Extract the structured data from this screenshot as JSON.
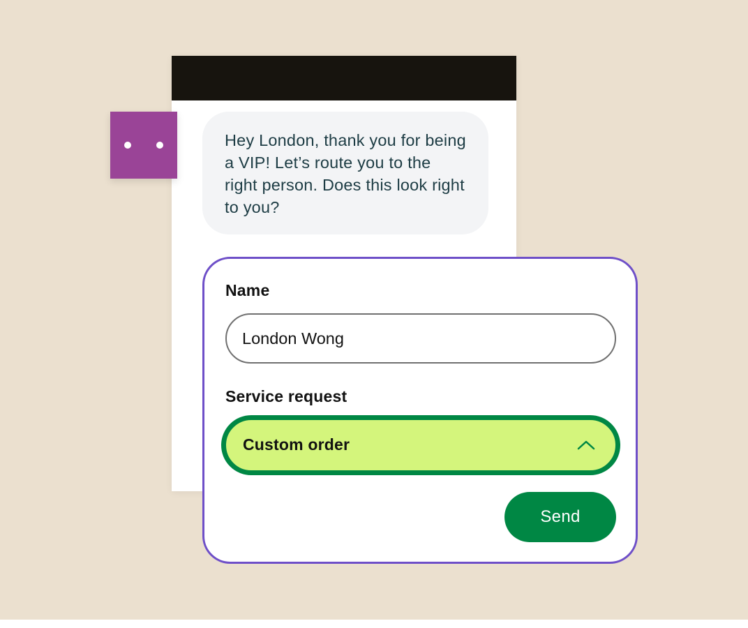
{
  "colors": {
    "background": "#ebe0cf",
    "header": "#17140e",
    "avatar": "#9a4497",
    "bubble": "#f3f4f6",
    "bubble_text": "#1d3c44",
    "form_border": "#6e4fc8",
    "select_fill": "#d4f57c",
    "accent_green": "#008744"
  },
  "avatar": {
    "icon": "bot-face-icon"
  },
  "chat": {
    "message": "Hey London, thank you for being a VIP! Let’s route you to the right person. Does this look right to you?"
  },
  "form": {
    "name_label": "Name",
    "name_value": "London Wong",
    "service_label": "Service request",
    "service_value": "Custom order",
    "service_icon": "chevron-up-icon",
    "send_label": "Send"
  }
}
